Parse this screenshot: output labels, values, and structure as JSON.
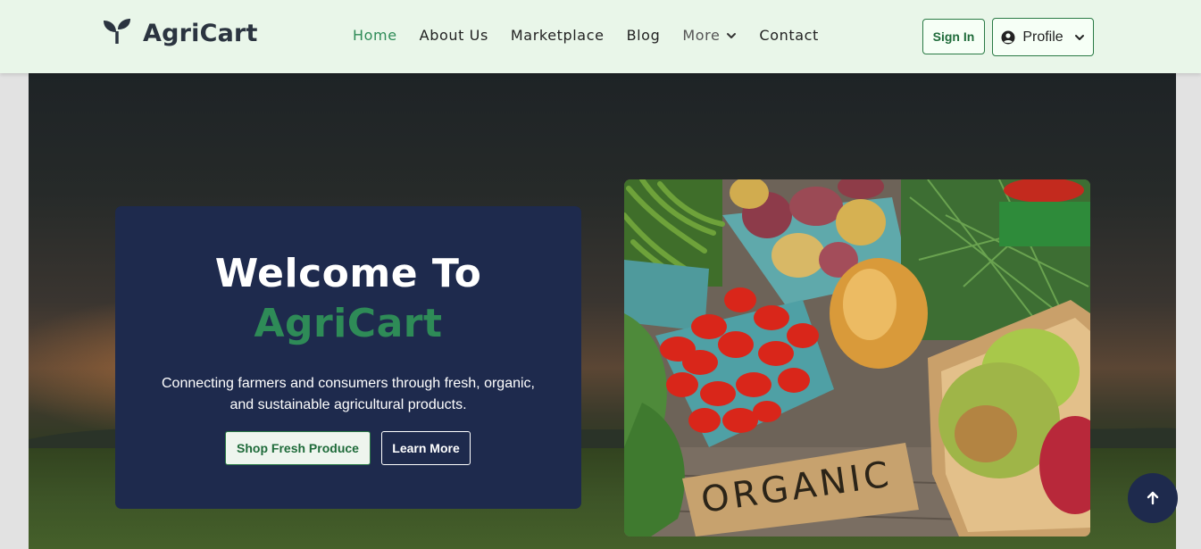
{
  "navbar": {
    "brand": "AgriCart",
    "links": [
      {
        "label": "Home"
      },
      {
        "label": "About Us"
      },
      {
        "label": "Marketplace"
      },
      {
        "label": "Blog"
      },
      {
        "label": "More"
      },
      {
        "label": "Contact"
      }
    ],
    "signin_label": "Sign In",
    "profile_label": "Profile"
  },
  "hero": {
    "heading": "Welcome To",
    "brand": "AgriCart",
    "tagline": "Connecting farmers and consumers through fresh, organic, and sustainable agricultural products.",
    "shop_label": "Shop Fresh Produce",
    "learn_label": "Learn More",
    "photo_sign": "ORGANIC"
  },
  "icons": {
    "logo": "sprout-icon",
    "dropdown": "chevron-down-icon",
    "profile": "user-circle-icon",
    "scroll": "arrow-up-icon"
  },
  "colors": {
    "accent": "#2e8b57",
    "navbar_bg": "#e9f6e9",
    "card_bg": "#1e2a4d"
  }
}
